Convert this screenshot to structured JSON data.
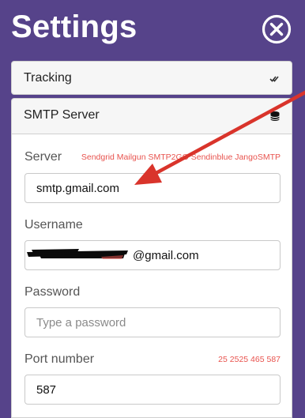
{
  "header": {
    "title": "Settings"
  },
  "sections": {
    "tracking": {
      "label": "Tracking"
    },
    "smtp": {
      "label": "SMTP Server"
    }
  },
  "fields": {
    "server": {
      "label": "Server",
      "hint": "Sendgrid Mailgun SMTP2GO Sendinblue JangoSMTP",
      "value": "smtp.gmail.com"
    },
    "username": {
      "label": "Username",
      "value": "@gmail.com"
    },
    "password": {
      "label": "Password",
      "placeholder": "Type a password",
      "value": ""
    },
    "port": {
      "label": "Port number",
      "hint": "25 2525 465 587",
      "value": "587"
    }
  },
  "icons": {
    "close": "close-circle-icon",
    "tracking": "double-check-icon",
    "smtp": "database-icon"
  },
  "colors": {
    "background": "#56438a",
    "hint": "#e8534e",
    "arrow": "#d9342b"
  }
}
